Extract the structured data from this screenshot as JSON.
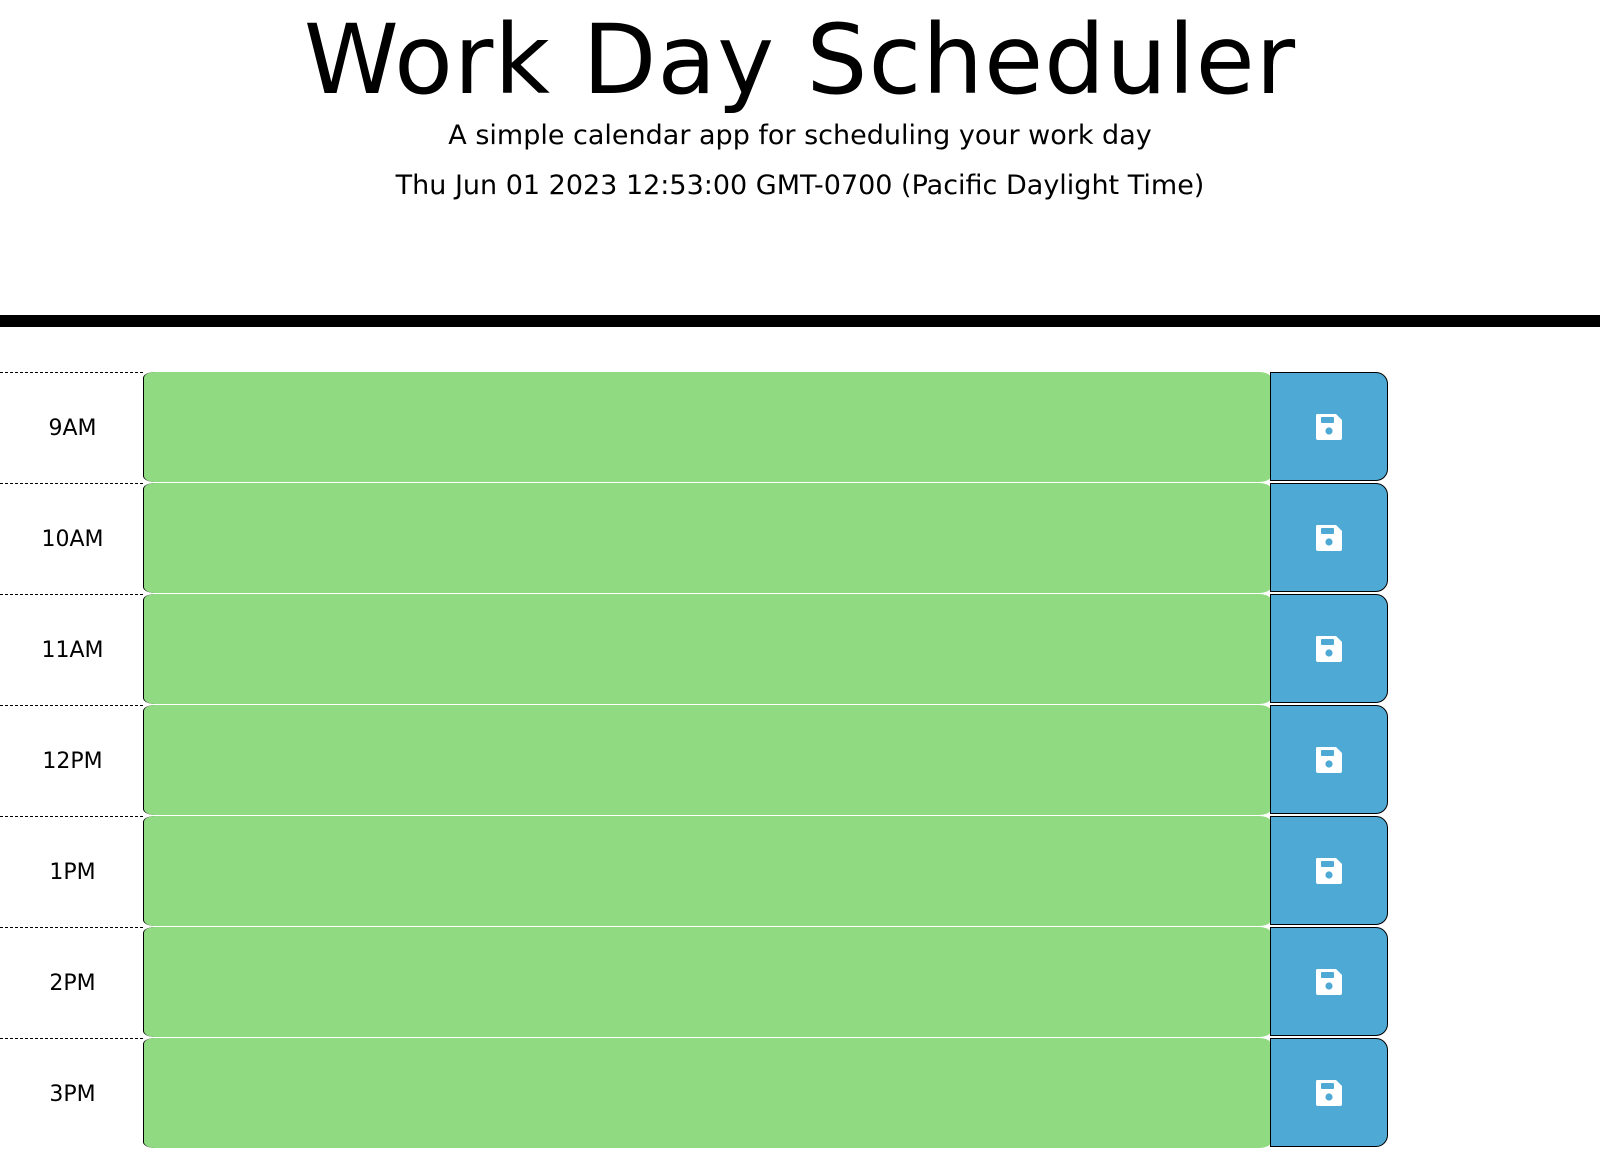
{
  "header": {
    "title": "Work Day Scheduler",
    "lead": "A simple calendar app for scheduling your work day",
    "current_day": "Thu Jun 01 2023 12:53:00 GMT-0700 (Pacific Daylight Time)"
  },
  "colors": {
    "present_block": "#90db82",
    "save_button": "#4eaad4"
  },
  "save_icon": "save-icon",
  "time_blocks": [
    {
      "hour": "9AM",
      "description": ""
    },
    {
      "hour": "10AM",
      "description": ""
    },
    {
      "hour": "11AM",
      "description": ""
    },
    {
      "hour": "12PM",
      "description": ""
    },
    {
      "hour": "1PM",
      "description": ""
    },
    {
      "hour": "2PM",
      "description": ""
    },
    {
      "hour": "3PM",
      "description": ""
    }
  ]
}
